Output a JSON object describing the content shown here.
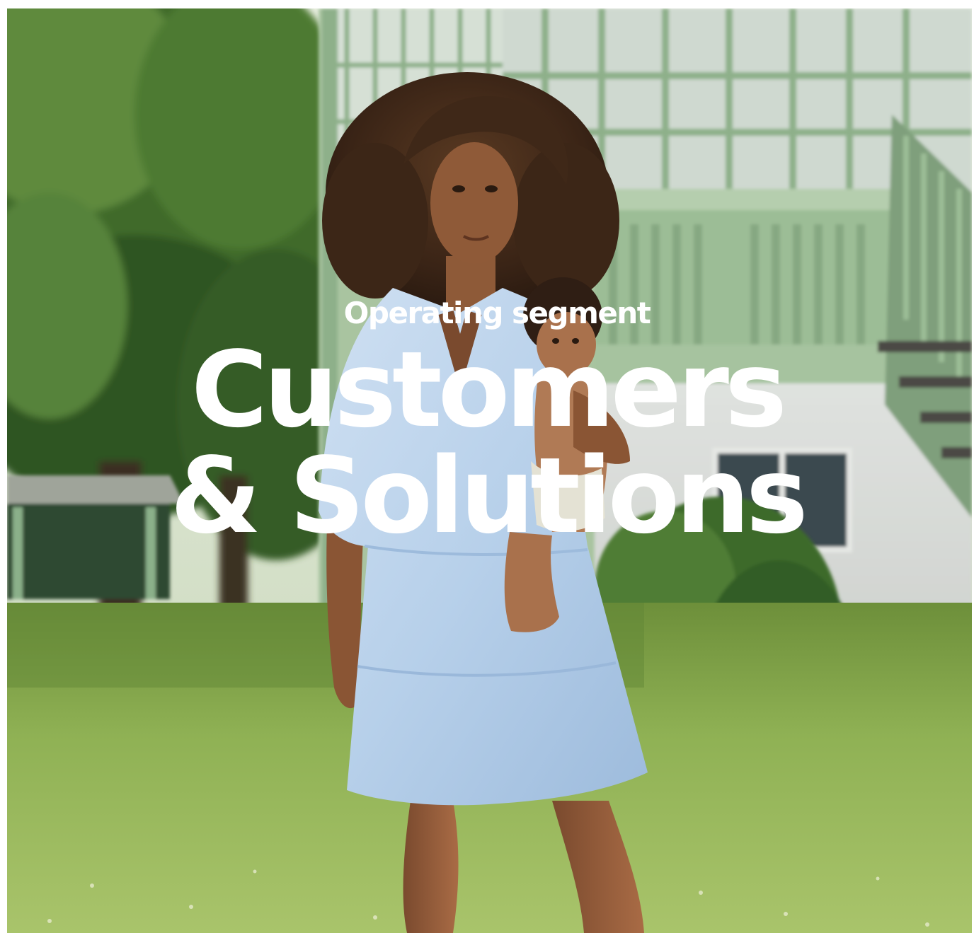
{
  "heading": {
    "label": "Operating segment",
    "title_line_1": "Customers",
    "title_line_2": "& Solutions"
  },
  "colors": {
    "text": "#ffffff",
    "lawn": "#86a84f",
    "house_green": "#8eb08a",
    "dress": "#b9d2ec",
    "foliage": "#355c26"
  }
}
